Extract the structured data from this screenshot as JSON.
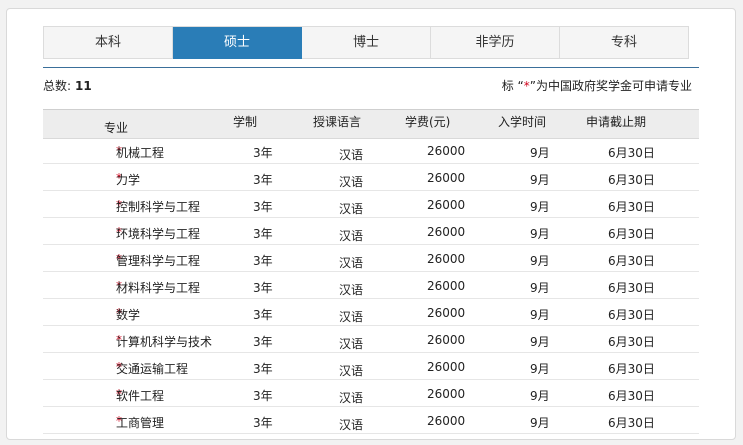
{
  "tabs": [
    {
      "label": "本科",
      "active": false
    },
    {
      "label": "硕士",
      "active": true
    },
    {
      "label": "博士",
      "active": false
    },
    {
      "label": "非学历",
      "active": false
    },
    {
      "label": "专科",
      "active": false
    }
  ],
  "summary": {
    "total_label": "总数:",
    "total_value": "11",
    "note_prefix": "标 “",
    "note_star": "*",
    "note_suffix": "”为中国政府奖学金可申请专业"
  },
  "table": {
    "headers": [
      "专业",
      "学制",
      "授课语言",
      "学费(元)",
      "入学时间",
      "申请截止期"
    ],
    "rows": [
      {
        "major": "机械工程",
        "duration": "3年",
        "language": "汉语",
        "tuition": "26000",
        "intake": "9月",
        "deadline": "6月30日"
      },
      {
        "major": "力学",
        "duration": "3年",
        "language": "汉语",
        "tuition": "26000",
        "intake": "9月",
        "deadline": "6月30日"
      },
      {
        "major": "控制科学与工程",
        "duration": "3年",
        "language": "汉语",
        "tuition": "26000",
        "intake": "9月",
        "deadline": "6月30日"
      },
      {
        "major": "环境科学与工程",
        "duration": "3年",
        "language": "汉语",
        "tuition": "26000",
        "intake": "9月",
        "deadline": "6月30日"
      },
      {
        "major": "管理科学与工程",
        "duration": "3年",
        "language": "汉语",
        "tuition": "26000",
        "intake": "9月",
        "deadline": "6月30日"
      },
      {
        "major": "材料科学与工程",
        "duration": "3年",
        "language": "汉语",
        "tuition": "26000",
        "intake": "9月",
        "deadline": "6月30日"
      },
      {
        "major": "数学",
        "duration": "3年",
        "language": "汉语",
        "tuition": "26000",
        "intake": "9月",
        "deadline": "6月30日"
      },
      {
        "major": "计算机科学与技术",
        "duration": "3年",
        "language": "汉语",
        "tuition": "26000",
        "intake": "9月",
        "deadline": "6月30日"
      },
      {
        "major": "交通运输工程",
        "duration": "3年",
        "language": "汉语",
        "tuition": "26000",
        "intake": "9月",
        "deadline": "6月30日"
      },
      {
        "major": "软件工程",
        "duration": "3年",
        "language": "汉语",
        "tuition": "26000",
        "intake": "9月",
        "deadline": "6月30日"
      },
      {
        "major": "工商管理",
        "duration": "3年",
        "language": "汉语",
        "tuition": "26000",
        "intake": "9月",
        "deadline": "6月30日"
      }
    ],
    "row_star": "*"
  },
  "colors": {
    "accent": "#2a7db7",
    "star": "#d0021b"
  }
}
